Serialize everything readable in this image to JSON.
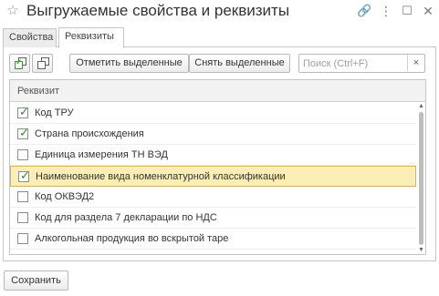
{
  "window": {
    "title": "Выгружаемые свойства и реквизиты"
  },
  "tabs": [
    {
      "label": "Свойства",
      "active": false
    },
    {
      "label": "Реквизиты",
      "active": true
    }
  ],
  "toolbar": {
    "mark_label": "Отметить выделенные",
    "unmark_label": "Снять выделенные",
    "search_placeholder": "Поиск (Ctrl+F)",
    "search_value": "",
    "clear_label": "×"
  },
  "table": {
    "column_header": "Реквизит",
    "rows": [
      {
        "label": "Код ТРУ",
        "checked": true,
        "selected": false
      },
      {
        "label": "Страна происхождения",
        "checked": true,
        "selected": false
      },
      {
        "label": "Единица измерения ТН ВЭД",
        "checked": false,
        "selected": false
      },
      {
        "label": "Наименование вида номенклатурной классификации",
        "checked": true,
        "selected": true
      },
      {
        "label": "Код ОКВЭД2",
        "checked": false,
        "selected": false
      },
      {
        "label": "Код для раздела 7 декларации по НДС",
        "checked": false,
        "selected": false
      },
      {
        "label": "Алкогольная продукция во вскрытой таре",
        "checked": false,
        "selected": false
      }
    ]
  },
  "footer": {
    "save_label": "Сохранить"
  },
  "colors": {
    "selected_row_bg": "#fbeeb4",
    "selected_row_border": "#e6b42f",
    "check_green": "#2e8b2e"
  },
  "icons": {
    "favorite": "star-icon",
    "link": "link-icon",
    "more": "more-icon",
    "maximize": "maximize-icon",
    "close": "close-icon"
  }
}
